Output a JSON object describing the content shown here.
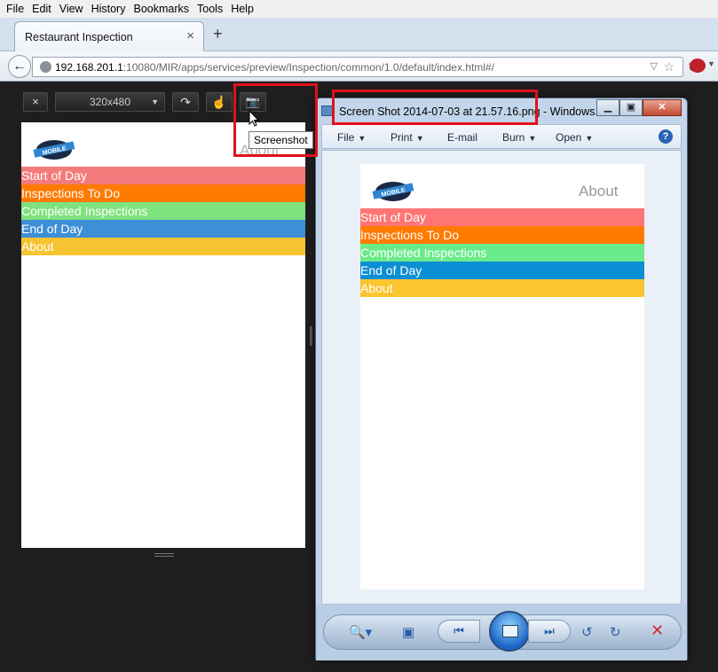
{
  "browser": {
    "menu": [
      "File",
      "Edit",
      "View",
      "History",
      "Bookmarks",
      "Tools",
      "Help"
    ],
    "tab_title": "Restaurant Inspection",
    "tab_close": "×",
    "new_tab": "+",
    "url_host": "192.168.201.1",
    "url_rest": ":10080/MIR/apps/services/preview/Inspection/common/1.0/default/index.html#/"
  },
  "emulator": {
    "close_glyph": "×",
    "resolution": "320x480",
    "rotate_glyph": "↷",
    "touch_glyph": "☝",
    "screenshot_glyph": "📷",
    "tooltip": "Screenshot"
  },
  "app": {
    "logo_text": "MOBILE",
    "header_about": "About",
    "menu": [
      {
        "label": "Start of Day",
        "color": "#f47b7b"
      },
      {
        "label": "Inspections To Do",
        "color": "#ff7a00"
      },
      {
        "label": "Completed Inspections",
        "color": "#7ee27e"
      },
      {
        "label": "End of Day",
        "color": "#3d8fd6"
      },
      {
        "label": "About",
        "color": "#f5c431"
      }
    ]
  },
  "shot_app": {
    "logo_text": "MOBILE",
    "header_about": "About",
    "menu": [
      {
        "label": "Start of Day",
        "color": "#ff7575"
      },
      {
        "label": "Inspections To Do",
        "color": "#ff7a00"
      },
      {
        "label": "Completed Inspections",
        "color": "#6aeb8a"
      },
      {
        "label": "End of Day",
        "color": "#0b8fd4"
      },
      {
        "label": "About",
        "color": "#fbc531"
      }
    ]
  },
  "photo_viewer": {
    "title": "Screen Shot 2014-07-03 at 21.57.16.png - Windows...",
    "minimize": "▁",
    "maximize": "▣",
    "close": "✕",
    "menu": {
      "file": "File",
      "print": "Print",
      "email": "E-mail",
      "burn": "Burn",
      "open": "Open"
    },
    "help": "?"
  },
  "colors": {
    "highlight": "#e0111b"
  }
}
